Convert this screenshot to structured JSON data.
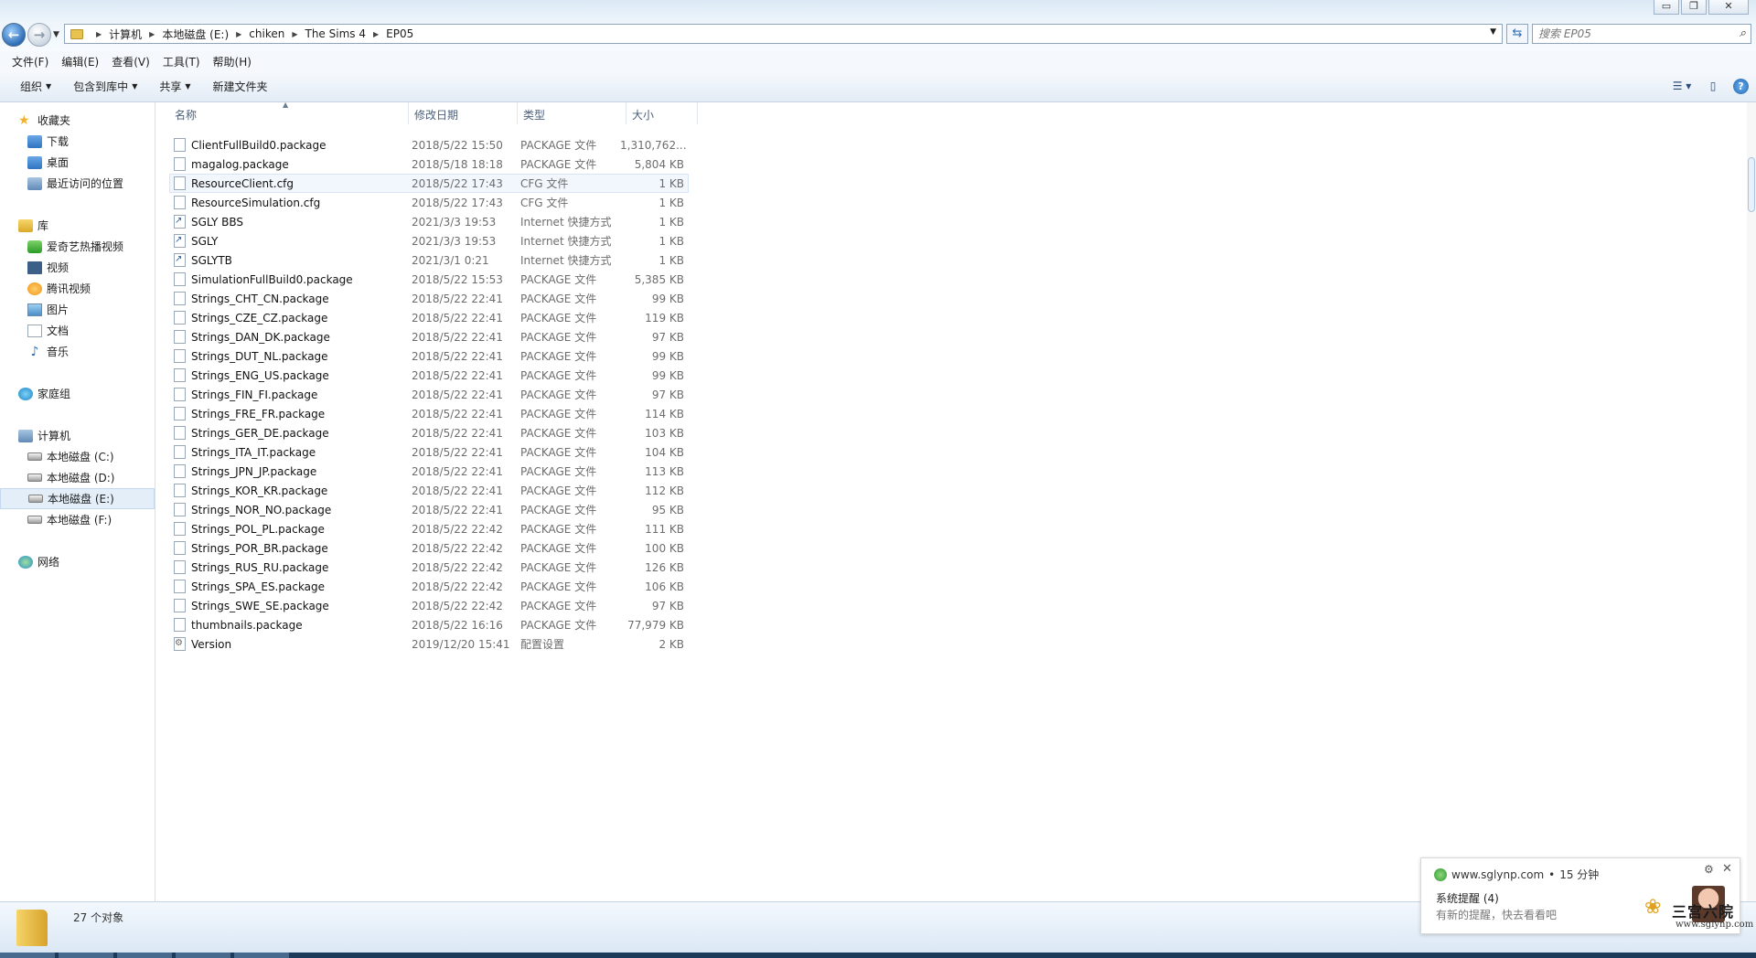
{
  "window": {
    "controls": {
      "minimize": "▭",
      "restore": "❐",
      "close": "✕"
    }
  },
  "address": {
    "back_label": "←",
    "forward_label": "→",
    "breadcrumbs": [
      "计算机",
      "本地磁盘 (E:)",
      "chiken",
      "The Sims 4",
      "EP05"
    ],
    "search_placeholder": "搜索 EP05"
  },
  "menu": [
    "文件(F)",
    "编辑(E)",
    "查看(V)",
    "工具(T)",
    "帮助(H)"
  ],
  "toolbar": {
    "organize": "组织",
    "include_library": "包含到库中",
    "share": "共享",
    "new_folder": "新建文件夹"
  },
  "sidebar": {
    "favorites": {
      "label": "收藏夹",
      "items": [
        "下载",
        "桌面",
        "最近访问的位置"
      ]
    },
    "libraries": {
      "label": "库",
      "items": [
        "爱奇艺热播视频",
        "视频",
        "腾讯视频",
        "图片",
        "文档",
        "音乐"
      ]
    },
    "homegroup": {
      "label": "家庭组"
    },
    "computer": {
      "label": "计算机",
      "items": [
        "本地磁盘 (C:)",
        "本地磁盘 (D:)",
        "本地磁盘 (E:)",
        "本地磁盘 (F:)"
      ],
      "selected": "本地磁盘 (E:)"
    },
    "network": {
      "label": "网络"
    }
  },
  "columns": {
    "name": "名称",
    "modified": "修改日期",
    "type": "类型",
    "size": "大小"
  },
  "files": [
    {
      "name": "ClientFullBuild0.package",
      "date": "2018/5/22 15:50",
      "type": "PACKAGE 文件",
      "size": "1,310,762...",
      "icon": "file-icon"
    },
    {
      "name": "magalog.package",
      "date": "2018/5/18 18:18",
      "type": "PACKAGE 文件",
      "size": "5,804 KB",
      "icon": "file-icon"
    },
    {
      "name": "ResourceClient.cfg",
      "date": "2018/5/22 17:43",
      "type": "CFG 文件",
      "size": "1 KB",
      "icon": "file-icon"
    },
    {
      "name": "ResourceSimulation.cfg",
      "date": "2018/5/22 17:43",
      "type": "CFG 文件",
      "size": "1 KB",
      "icon": "file-icon"
    },
    {
      "name": "SGLY BBS",
      "date": "2021/3/3 19:53",
      "type": "Internet 快捷方式",
      "size": "1 KB",
      "icon": "shortcut-icon"
    },
    {
      "name": "SGLY",
      "date": "2021/3/3 19:53",
      "type": "Internet 快捷方式",
      "size": "1 KB",
      "icon": "shortcut-icon"
    },
    {
      "name": "SGLYTB",
      "date": "2021/3/1 0:21",
      "type": "Internet 快捷方式",
      "size": "1 KB",
      "icon": "shortcut-icon"
    },
    {
      "name": "SimulationFullBuild0.package",
      "date": "2018/5/22 15:53",
      "type": "PACKAGE 文件",
      "size": "5,385 KB",
      "icon": "file-icon"
    },
    {
      "name": "Strings_CHT_CN.package",
      "date": "2018/5/22 22:41",
      "type": "PACKAGE 文件",
      "size": "99 KB",
      "icon": "file-icon"
    },
    {
      "name": "Strings_CZE_CZ.package",
      "date": "2018/5/22 22:41",
      "type": "PACKAGE 文件",
      "size": "119 KB",
      "icon": "file-icon"
    },
    {
      "name": "Strings_DAN_DK.package",
      "date": "2018/5/22 22:41",
      "type": "PACKAGE 文件",
      "size": "97 KB",
      "icon": "file-icon"
    },
    {
      "name": "Strings_DUT_NL.package",
      "date": "2018/5/22 22:41",
      "type": "PACKAGE 文件",
      "size": "99 KB",
      "icon": "file-icon"
    },
    {
      "name": "Strings_ENG_US.package",
      "date": "2018/5/22 22:41",
      "type": "PACKAGE 文件",
      "size": "99 KB",
      "icon": "file-icon"
    },
    {
      "name": "Strings_FIN_FI.package",
      "date": "2018/5/22 22:41",
      "type": "PACKAGE 文件",
      "size": "97 KB",
      "icon": "file-icon"
    },
    {
      "name": "Strings_FRE_FR.package",
      "date": "2018/5/22 22:41",
      "type": "PACKAGE 文件",
      "size": "114 KB",
      "icon": "file-icon"
    },
    {
      "name": "Strings_GER_DE.package",
      "date": "2018/5/22 22:41",
      "type": "PACKAGE 文件",
      "size": "103 KB",
      "icon": "file-icon"
    },
    {
      "name": "Strings_ITA_IT.package",
      "date": "2018/5/22 22:41",
      "type": "PACKAGE 文件",
      "size": "104 KB",
      "icon": "file-icon"
    },
    {
      "name": "Strings_JPN_JP.package",
      "date": "2018/5/22 22:41",
      "type": "PACKAGE 文件",
      "size": "113 KB",
      "icon": "file-icon"
    },
    {
      "name": "Strings_KOR_KR.package",
      "date": "2018/5/22 22:41",
      "type": "PACKAGE 文件",
      "size": "112 KB",
      "icon": "file-icon"
    },
    {
      "name": "Strings_NOR_NO.package",
      "date": "2018/5/22 22:41",
      "type": "PACKAGE 文件",
      "size": "95 KB",
      "icon": "file-icon"
    },
    {
      "name": "Strings_POL_PL.package",
      "date": "2018/5/22 22:42",
      "type": "PACKAGE 文件",
      "size": "111 KB",
      "icon": "file-icon"
    },
    {
      "name": "Strings_POR_BR.package",
      "date": "2018/5/22 22:42",
      "type": "PACKAGE 文件",
      "size": "100 KB",
      "icon": "file-icon"
    },
    {
      "name": "Strings_RUS_RU.package",
      "date": "2018/5/22 22:42",
      "type": "PACKAGE 文件",
      "size": "126 KB",
      "icon": "file-icon"
    },
    {
      "name": "Strings_SPA_ES.package",
      "date": "2018/5/22 22:42",
      "type": "PACKAGE 文件",
      "size": "106 KB",
      "icon": "file-icon"
    },
    {
      "name": "Strings_SWE_SE.package",
      "date": "2018/5/22 22:42",
      "type": "PACKAGE 文件",
      "size": "97 KB",
      "icon": "file-icon"
    },
    {
      "name": "thumbnails.package",
      "date": "2018/5/22 16:16",
      "type": "PACKAGE 文件",
      "size": "77,979 KB",
      "icon": "file-icon"
    },
    {
      "name": "Version",
      "date": "2019/12/20 15:41",
      "type": "配置设置",
      "size": "2 KB",
      "icon": "config-icon"
    }
  ],
  "details": {
    "count": "27 个对象"
  },
  "notification": {
    "source": "www.sglynp.com",
    "time": "15 分钟",
    "title": "系统提醒 (4)",
    "message": "有新的提醒，快去看看吧"
  },
  "watermark": {
    "text": "三宫六院",
    "url": "www.sglynp.com"
  },
  "colors": {
    "selection": "#e4eef9",
    "accent": "#2e6db5",
    "details_bg": "#dbe8f5"
  }
}
